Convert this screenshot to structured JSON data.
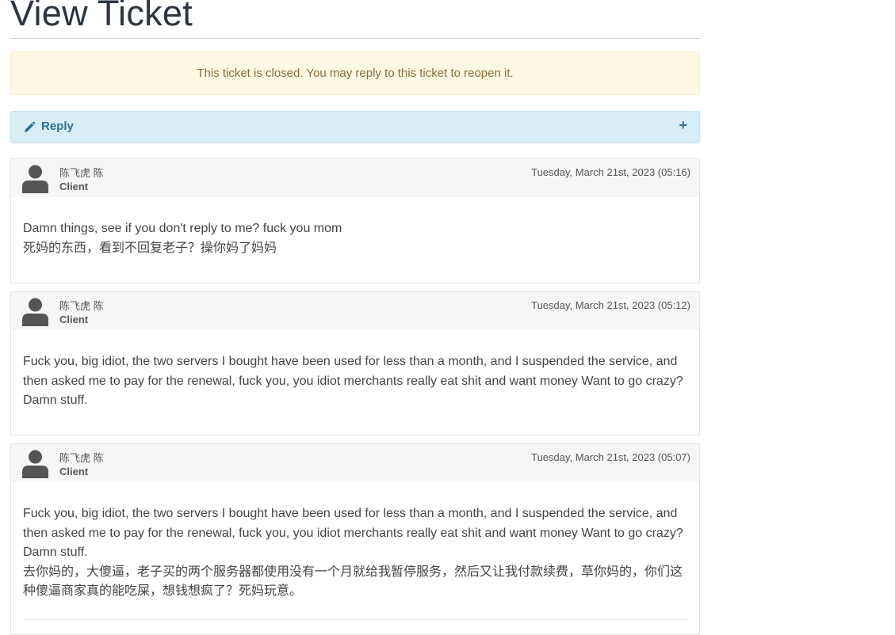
{
  "page": {
    "title": "View Ticket"
  },
  "alert": {
    "text": "This ticket is closed. You may reply to this ticket to reopen it."
  },
  "reply": {
    "label": "Reply",
    "toggle": "+",
    "icon": "pencil-icon"
  },
  "messages": [
    {
      "author": "陈飞虎 陈",
      "role": "Client",
      "date": "Tuesday, March 21st, 2023 (05:16)",
      "body": "Damn things, see if you don't reply to me? fuck you mom\n死妈的东西，看到不回复老子？操你妈了妈妈"
    },
    {
      "author": "陈飞虎 陈",
      "role": "Client",
      "date": "Tuesday, March 21st, 2023 (05:12)",
      "body": "Fuck you, big idiot, the two servers I bought have been used for less than a month, and I suspended the service, and then asked me to pay for the renewal, fuck you, you idiot merchants really eat shit and want money Want to go crazy? Damn stuff."
    },
    {
      "author": "陈飞虎 陈",
      "role": "Client",
      "date": "Tuesday, March 21st, 2023 (05:07)",
      "body": "Fuck you, big idiot, the two servers I bought have been used for less than a month, and I suspended the service, and then asked me to pay for the renewal, fuck you, you idiot merchants really eat shit and want money Want to go crazy? Damn stuff.\n去你妈的，大傻逼，老子买的两个服务器都使用没有一个月就给我暂停服务，然后又让我付款续费，草你妈的，你们这种傻逼商家真的能吃屎，想钱想疯了？死妈玩意。"
    }
  ],
  "colors": {
    "alert_bg": "#fcf8e3",
    "alert_text": "#8a6d3b",
    "reply_bg": "#d9edf7",
    "reply_text": "#31708f",
    "header_bg": "#f6f6f6"
  }
}
